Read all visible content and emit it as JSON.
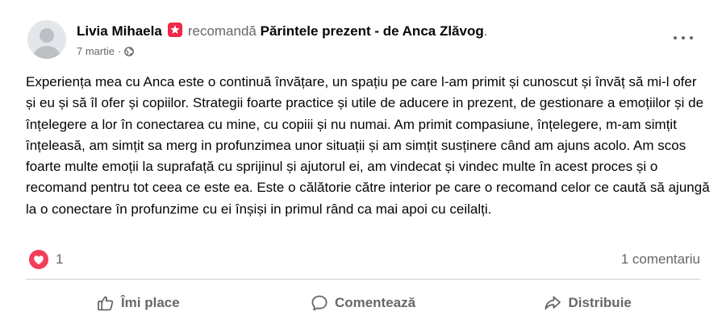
{
  "post": {
    "author": "Livia Mihaela",
    "action_text": "recomandă",
    "page_name": "Părintele prezent - de Anca Zlăvog",
    "page_suffix": ".",
    "date": "7 martie",
    "separator": "·",
    "privacy_icon": "globe-icon",
    "body": "Experiența mea cu Anca este o continuă învățare, un spațiu pe care l-am primit și cunoscut și învăț să mi-l ofer și eu și să îl ofer și copiilor. Strategii foarte practice și utile de aducere in prezent, de gestionare a emoțiilor și de înțelegere a lor în conectarea cu mine, cu copiii și nu numai. Am primit compasiune, înțelegere, m-am simțit înțeleasă, am simțit sa merg in profunzimea unor situații și am simțit susținere când am ajuns acolo. Am scos foarte multe emoții la suprafață cu sprijinul și ajutorul ei, am vindecat și vindec multe în acest proces și o recomand pentru tot ceea ce este ea. Este o călătorie către interior pe care o recomand celor ce caută să ajungă la o conectare în profunzime cu ei înșiși in primul rând ca mai apoi cu ceilalți."
  },
  "stats": {
    "reaction_icon": "heart-icon",
    "reaction_count": "1",
    "comments": "1 comentariu"
  },
  "actions": {
    "like": "Îmi place",
    "comment": "Comentează",
    "share": "Distribuie"
  },
  "colors": {
    "text": "#050505",
    "muted": "#65676b",
    "divider": "#ced0d4",
    "recommend_badge": "#f02849",
    "reaction_heart": "#f33e58"
  }
}
